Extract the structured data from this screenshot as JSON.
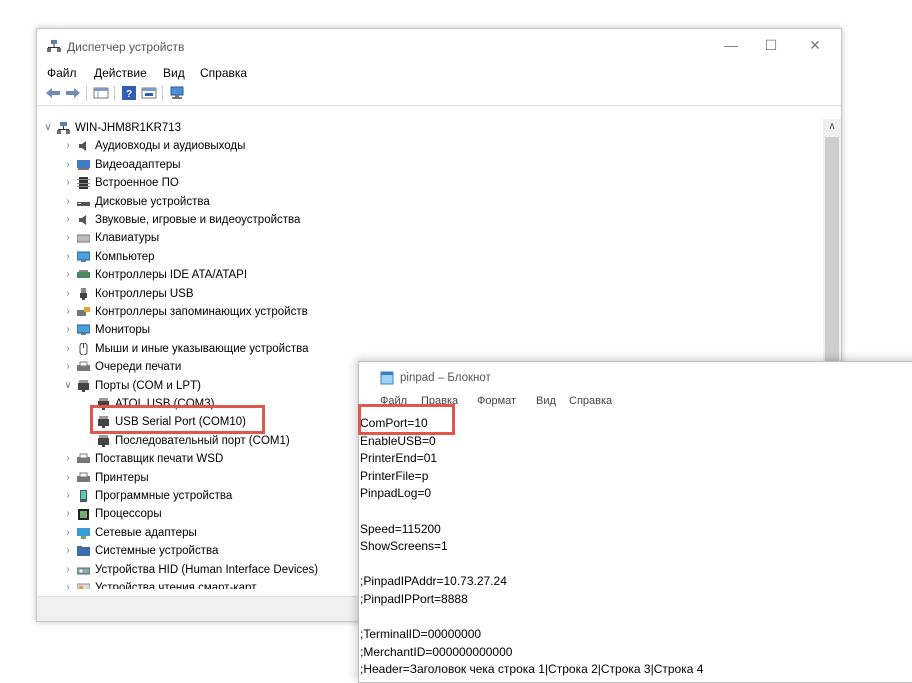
{
  "device_manager": {
    "title": "Диспетчер устройств",
    "menu": [
      "Файл",
      "Действие",
      "Вид",
      "Справка"
    ],
    "tree": [
      {
        "label": "WIN-JHM8R1KR713",
        "level": 0,
        "expanded": true,
        "icon": "computer-icon"
      },
      {
        "label": "Аудиовходы и аудиовыходы",
        "level": 1,
        "icon": "speaker-icon"
      },
      {
        "label": "Видеоадаптеры",
        "level": 1,
        "icon": "display-adapter-icon"
      },
      {
        "label": "Встроенное ПО",
        "level": 1,
        "icon": "firmware-icon"
      },
      {
        "label": "Дисковые устройства",
        "level": 1,
        "icon": "disk-icon"
      },
      {
        "label": "Звуковые, игровые и видеоустройства",
        "level": 1,
        "icon": "speaker-icon"
      },
      {
        "label": "Клавиатуры",
        "level": 1,
        "icon": "keyboard-icon"
      },
      {
        "label": "Компьютер",
        "level": 1,
        "icon": "monitor-icon"
      },
      {
        "label": "Контроллеры IDE ATA/ATAPI",
        "level": 1,
        "icon": "ide-icon"
      },
      {
        "label": "Контроллеры USB",
        "level": 1,
        "icon": "usb-icon"
      },
      {
        "label": "Контроллеры запоминающих устройств",
        "level": 1,
        "icon": "storage-icon"
      },
      {
        "label": "Мониторы",
        "level": 1,
        "icon": "monitor-icon"
      },
      {
        "label": "Мыши и иные указывающие устройства",
        "level": 1,
        "icon": "mouse-icon"
      },
      {
        "label": "Очереди печати",
        "level": 1,
        "icon": "printer-icon"
      },
      {
        "label": "Порты (COM и LPT)",
        "level": 1,
        "expanded": true,
        "icon": "port-icon"
      },
      {
        "label": "ATOL USB (COM3)",
        "level": 2,
        "icon": "port-icon"
      },
      {
        "label": "USB Serial Port (COM10)",
        "level": 2,
        "icon": "port-icon"
      },
      {
        "label": "Последовательный порт (COM1)",
        "level": 2,
        "icon": "port-icon"
      },
      {
        "label": "Поставщик печати WSD",
        "level": 1,
        "icon": "printer-icon"
      },
      {
        "label": "Принтеры",
        "level": 1,
        "icon": "printer-icon"
      },
      {
        "label": "Программные устройства",
        "level": 1,
        "icon": "software-device-icon"
      },
      {
        "label": "Процессоры",
        "level": 1,
        "icon": "cpu-icon"
      },
      {
        "label": "Сетевые адаптеры",
        "level": 1,
        "icon": "network-icon"
      },
      {
        "label": "Системные устройства",
        "level": 1,
        "icon": "folder-icon"
      },
      {
        "label": "Устройства HID (Human Interface Devices)",
        "level": 1,
        "icon": "hid-icon"
      },
      {
        "label": "Устройства чтения смарт-карт",
        "level": 1,
        "icon": "smartcard-icon"
      }
    ]
  },
  "notepad": {
    "title": "pinpad – Блокнот",
    "menu": [
      "Файл",
      "Правка",
      "Формат",
      "Вид",
      "Справка"
    ],
    "lines": [
      "ComPort=10",
      "EnableUSB=0",
      "PrinterEnd=01",
      "PrinterFile=p",
      "PinpadLog=0",
      "",
      "Speed=115200",
      "ShowScreens=1",
      "",
      ";PinpadIPAddr=10.73.27.24",
      ";PinpadIPPort=8888",
      "",
      ";TerminalID=00000000",
      ";MerchantID=000000000000",
      ";Header=Заголовок чека строка 1|Строка 2|Строка 3|Строка 4"
    ]
  },
  "colors": {
    "highlight": "#e2574c",
    "scroll_thumb": "#cdcdcd"
  }
}
